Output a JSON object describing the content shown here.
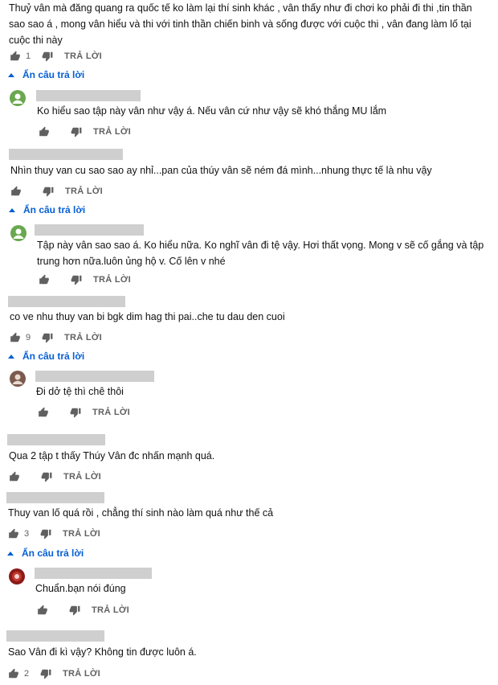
{
  "labels": {
    "reply": "TRẢ LỜI",
    "hide_replies": "Ẩn câu trả lời"
  },
  "icons": {
    "like": "thumbs-up-icon",
    "dislike": "thumbs-down-icon",
    "collapse": "caret-up-icon"
  },
  "colors": {
    "link": "#065fd4",
    "meta": "#606060",
    "placeholder_bar": "#cfcfcf"
  },
  "comments": [
    {
      "text": "Thuỷ vân mà đăng quang ra quốc tế ko làm lại thí sinh khác , vân thấy như đi chơi ko phải đi thi ,tin thần sao sao á , mong vân hiểu và thi với tinh thần chiến binh và sống được với cuộc thi , vân đang làm lố tại cuộc thi này",
      "likes": "1"
    },
    {
      "text": "Ko hiểu sao tập này vân như vậy á. Nếu vân cứ như vậy sẽ khó thắng MU lắm",
      "likes": ""
    },
    {
      "text": "Nhìn thuy van cu sao sao ay nhỉ...pan của thúy vân sẽ ném đá mình...nhung thực tế là nhu vậy",
      "likes": ""
    },
    {
      "text": "Tập này vân sao sao á. Ko hiểu nữa. Ko nghĩ vân đi tệ vậy. Hơi thất vọng. Mong v sẽ cố gắng và tập trung hơn nữa.luôn ủng hộ v. Cố lên v nhé",
      "likes": ""
    },
    {
      "text": "co ve nhu thuy van bi bgk dim hag thi pai..che tu dau den cuoi",
      "likes": "9"
    },
    {
      "text": "Đi dở tệ thì chê thôi",
      "likes": ""
    },
    {
      "text": "Qua 2 tập t thấy Thúy Vân đc nhấn mạnh quá.",
      "likes": ""
    },
    {
      "text": "Thuy van lố quá rồi , chẳng thí sinh nào làm quá như thế cả",
      "likes": "3"
    },
    {
      "text": "Chuẩn.bạn nói đúng",
      "likes": ""
    },
    {
      "text": "Sao Vân đi kì vậy? Không tin được luôn á.",
      "likes": "2"
    }
  ]
}
